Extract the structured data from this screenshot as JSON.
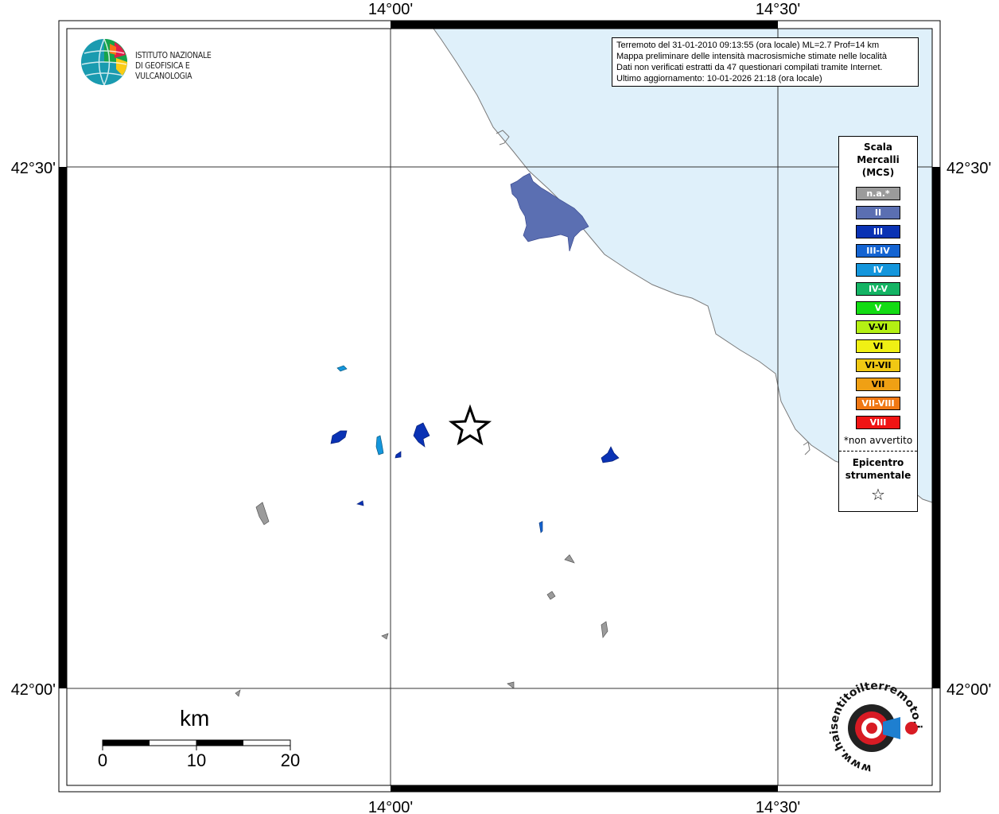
{
  "map": {
    "lon_labels": [
      "14°00'",
      "14°30'"
    ],
    "lat_labels": [
      "42°30'",
      "42°00'"
    ]
  },
  "info": {
    "line1": "Terremoto del 31-01-2010 09:13:55 (ora locale) ML=2.7 Prof=14 km",
    "line2": "Mappa preliminare delle intensità macrosismiche stimate nelle località",
    "line3": "Dati non verificati estratti da 47 questionari compilati tramite Internet.",
    "line4": "Ultimo aggiornamento: 10-01-2026 21:18 (ora locale)"
  },
  "logo": {
    "line1": "ISTITUTO NAZIONALE",
    "line2": "DI GEOFISICA E VULCANOLOGIA",
    "icon": "globe-icon"
  },
  "legend": {
    "title1": "Scala",
    "title2": "Mercalli",
    "title3": "(MCS)",
    "items": [
      {
        "label": "n.a.*",
        "color": "#9b9b9b"
      },
      {
        "label": "II",
        "color": "#5b6fb2"
      },
      {
        "label": "III",
        "color": "#0a32b4"
      },
      {
        "label": "III-IV",
        "color": "#1464d2"
      },
      {
        "label": "IV",
        "color": "#1496dc"
      },
      {
        "label": "IV-V",
        "color": "#14b464"
      },
      {
        "label": "V",
        "color": "#14dc14"
      },
      {
        "label": "V-VI",
        "color": "#b4f014"
      },
      {
        "label": "VI",
        "color": "#f0f014"
      },
      {
        "label": "VI-VII",
        "color": "#f0c814"
      },
      {
        "label": "VII",
        "color": "#f0a014"
      },
      {
        "label": "VII-VIII",
        "color": "#f07814"
      },
      {
        "label": "VIII",
        "color": "#f01414"
      }
    ],
    "note": "*non avvertito",
    "epi1": "Epicentro",
    "epi2": "strumentale",
    "star": "☆"
  },
  "scalebar": {
    "title": "km",
    "ticks": [
      "0",
      "10",
      "20"
    ]
  },
  "colors": {
    "sea": "#dff0fa",
    "coast": "#8a8a8a",
    "grid": "#000000"
  },
  "hai_logo": {
    "text": "www.haisentitoilterremoto.it",
    "icon": "speaker-icon"
  }
}
